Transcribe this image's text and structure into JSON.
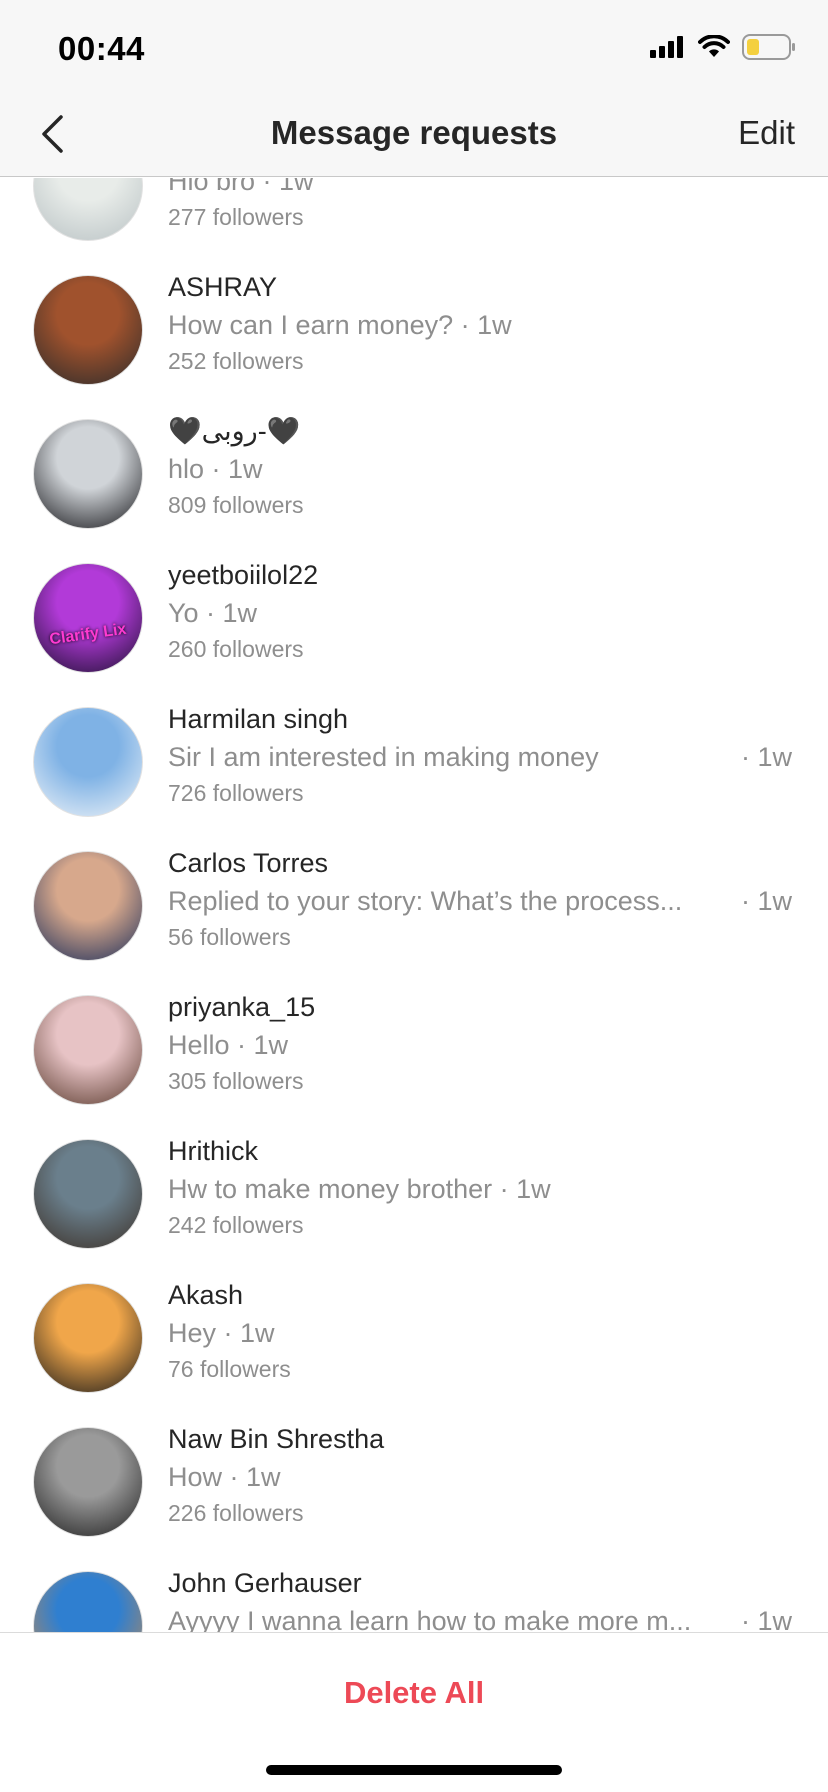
{
  "status_bar": {
    "time": "00:44",
    "battery_color": "#f4d03f"
  },
  "header": {
    "title": "Message requests",
    "edit_label": "Edit"
  },
  "requests": [
    {
      "name": "",
      "message": "Hlo bro",
      "time": "· 1w",
      "followers": "277 followers",
      "avatar_colors": [
        "#e8ece9",
        "#b9c2c4"
      ]
    },
    {
      "name": "ASHRAY",
      "message": "How can I earn money?",
      "time": "· 1w",
      "followers": "252 followers",
      "avatar_colors": [
        "#a0522d",
        "#2b2b2b"
      ]
    },
    {
      "name": "🖤روبی-🖤",
      "message": "hlo",
      "time": "· 1w",
      "followers": "809 followers",
      "avatar_colors": [
        "#d0d4d8",
        "#141418"
      ]
    },
    {
      "name": "yeetboiilol22",
      "message": "Yo",
      "time": "· 1w",
      "followers": "260 followers",
      "avatar_colors": [
        "#b23ad8",
        "#1c1030"
      ],
      "avatar_text": "Clarify Lix"
    },
    {
      "name": "Harmilan singh",
      "message": "Sir I am interested in making money",
      "time": "· 1w",
      "followers": "726 followers",
      "avatar_colors": [
        "#7fb2e5",
        "#eef3f8"
      ]
    },
    {
      "name": "Carlos Torres",
      "message": "Replied to your story: What’s the process...",
      "time": "· 1w",
      "followers": "56 followers",
      "avatar_colors": [
        "#d7a88c",
        "#1c2e5a"
      ]
    },
    {
      "name": "priyanka_15",
      "message": "Hello",
      "time": "· 1w",
      "followers": "305 followers",
      "avatar_colors": [
        "#e7c3c5",
        "#5a3b2e"
      ]
    },
    {
      "name": "Hrithick",
      "message": "Hw to make money brother",
      "time": "· 1w",
      "followers": "242 followers",
      "avatar_colors": [
        "#6a7f8c",
        "#3b2f26"
      ]
    },
    {
      "name": "Akash",
      "message": "Hey",
      "time": "· 1w",
      "followers": "76 followers",
      "avatar_colors": [
        "#f0a64a",
        "#1a1a1a"
      ]
    },
    {
      "name": "Naw Bin Shrestha",
      "message": "How",
      "time": "· 1w",
      "followers": "226 followers",
      "avatar_colors": [
        "#9a9a9a",
        "#1e1e1e"
      ]
    },
    {
      "name": "John Gerhauser",
      "message": "Ayyyy I wanna learn how to make more m...",
      "time": "· 1w",
      "followers": "",
      "avatar_colors": [
        "#2f7fd0",
        "#c98a4a"
      ]
    }
  ],
  "footer": {
    "delete_all_label": "Delete All"
  },
  "colors": {
    "accent_red": "#ed4956",
    "secondary_text": "#8e8e8e",
    "primary_text": "#262626"
  }
}
